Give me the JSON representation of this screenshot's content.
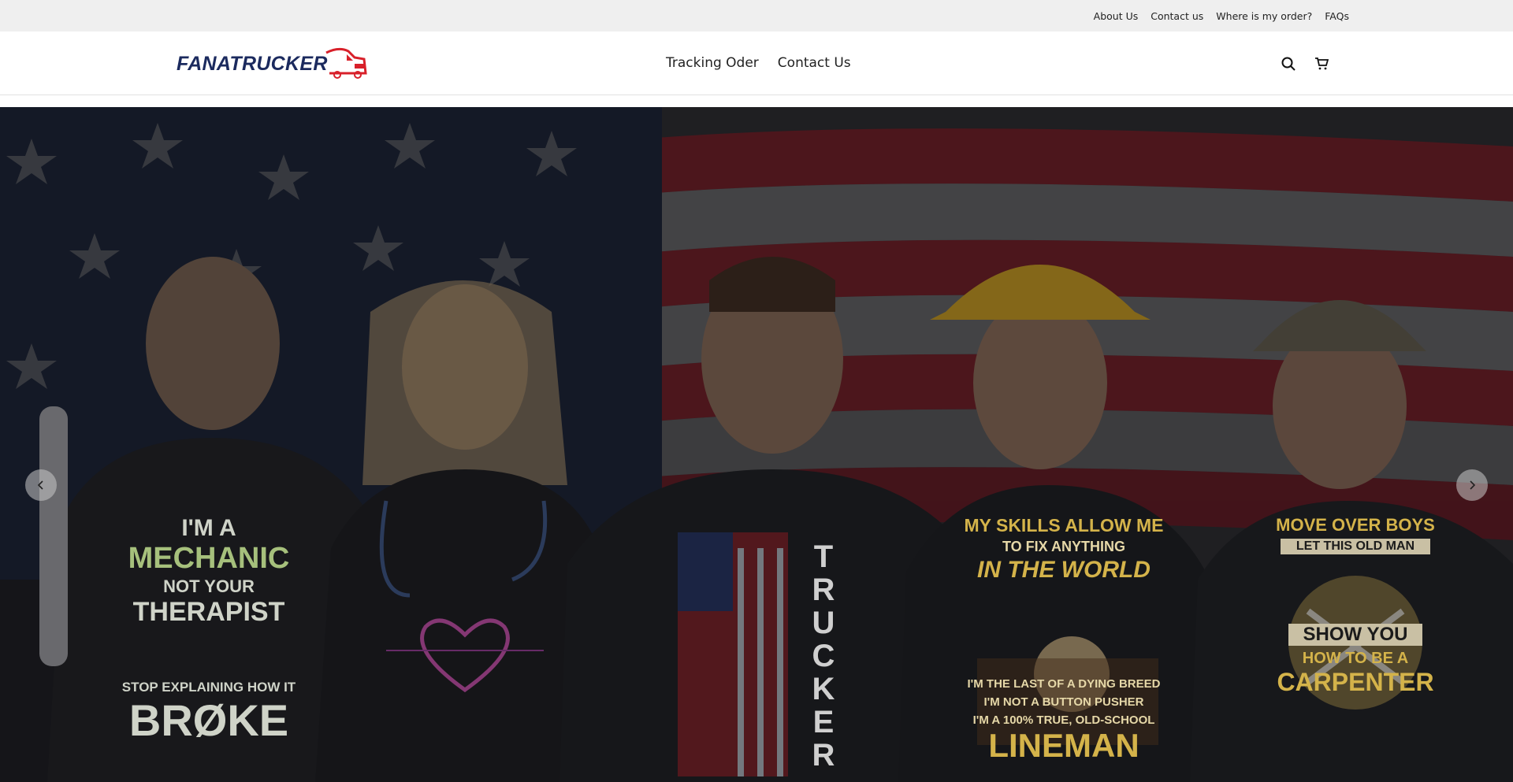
{
  "topbar": {
    "links": [
      "About Us",
      "Contact us",
      "Where is my order?",
      "FAQs"
    ]
  },
  "header": {
    "logo_text": "FANATRUCKER",
    "nav": [
      "Tracking Oder",
      "Contact Us"
    ],
    "icons": [
      "search-icon",
      "cart-icon"
    ]
  },
  "hero": {
    "shirts": {
      "mechanic": [
        "I'M A",
        "MECHANIC",
        "NOT YOUR",
        "THERAPIST",
        "STOP EXPLAINING HOW IT",
        "BRØKE"
      ],
      "trucker": "TRUCKER",
      "lineman": [
        "MY SKILLS ALLOW ME",
        "TO FIX ANYTHING",
        "IN THE WORLD",
        "I'M THE LAST OF A DYING BREED",
        "I'M NOT A BUTTON PUSHER",
        "I'M A 100% TRUE, OLD-SCHOOL",
        "LINEMAN"
      ],
      "carpenter": [
        "MOVE OVER BOYS",
        "LET THIS OLD MAN",
        "SHOW YOU",
        "HOW TO BE A",
        "CARPENTER"
      ]
    },
    "carousel_icons": [
      "chevron-left-icon",
      "chevron-right-icon"
    ]
  },
  "colors": {
    "topbar_bg": "#efefef",
    "logo_blue": "#1b2a5e",
    "logo_red": "#d8202a"
  }
}
